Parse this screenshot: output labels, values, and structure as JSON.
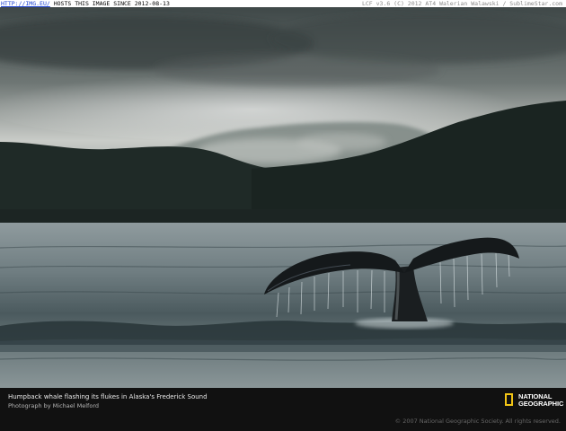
{
  "banner": {
    "host_link": "HTTP://IMG.EU/",
    "host_text": "HOSTS THIS IMAGE SINCE 2012-08-13",
    "right_text": "LCF v3.6 (C) 2012 AT4 Walerian Walawski / SublimeStar.com"
  },
  "caption": {
    "title": "Humpback whale flashing its flukes in Alaska's Frederick Sound",
    "credit": "Photograph by Michael Melford",
    "copyright": "© 2007 National Geographic Society. All rights reserved."
  },
  "logo": {
    "line1": "NATIONAL",
    "line2": "GEOGRAPHIC",
    "frame_color": "#f3c515"
  }
}
